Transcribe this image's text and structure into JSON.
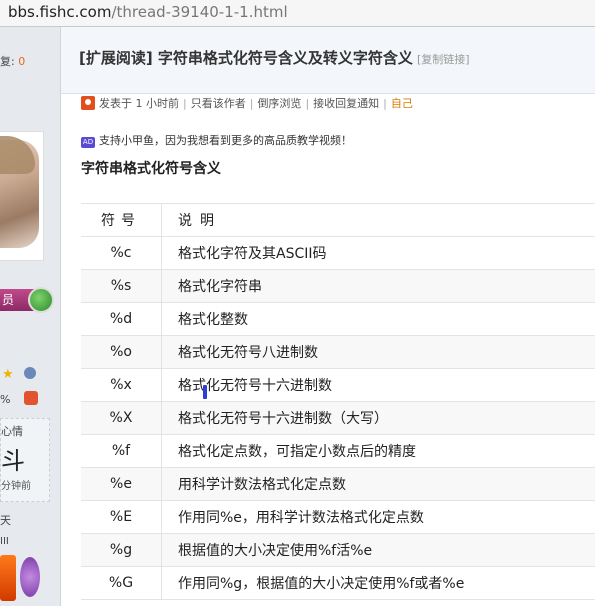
{
  "browser": {
    "url_domain": "bbs.fishc.com",
    "url_path": "/thread-39140-1-1.html"
  },
  "sidebar": {
    "reply_label": "复:",
    "reply_count": "0",
    "vip_label": "员",
    "percent_text": "%",
    "mood_line1": "心情",
    "mood_line2": "斗",
    "mood_line3": "分钟前",
    "days_text": "天",
    "level_text": "III"
  },
  "post": {
    "title": "[扩展阅读] 字符串格式化符号含义及转义字符含义",
    "copy_link": "[复制链接]",
    "posted": "发表于 1 小时前",
    "only_author": "只看该作者",
    "reverse": "倒序浏览",
    "notify": "接收回复通知",
    "self": "自己",
    "ad_text": "支持小甲鱼，因为我想看到更多的高品质教学视频！",
    "ad_badge": "AD",
    "section_title": "字符串格式化符号含义"
  },
  "table": {
    "headers": [
      "符号",
      "说明"
    ],
    "rows": [
      {
        "sym": "%c",
        "desc": "格式化字符及其ASCII码"
      },
      {
        "sym": "%s",
        "desc": "格式化字符串"
      },
      {
        "sym": "%d",
        "desc": "格式化整数"
      },
      {
        "sym": "%o",
        "desc": "格式化无符号八进制数"
      },
      {
        "sym": "%x",
        "desc": "格式化无符号十六进制数"
      },
      {
        "sym": "%X",
        "desc": "格式化无符号十六进制数（大写）"
      },
      {
        "sym": "%f",
        "desc": "格式化定点数，可指定小数点后的精度"
      },
      {
        "sym": "%e",
        "desc": "用科学计数法格式化定点数"
      },
      {
        "sym": "%E",
        "desc": "作用同%e，用科学计数法格式化定点数"
      },
      {
        "sym": "%g",
        "desc": "根据值的大小决定使用%f活%e"
      },
      {
        "sym": "%G",
        "desc": "作用同%g，根据值的大小决定使用%f或者%e"
      }
    ]
  },
  "colors": {
    "accent_orange": "#e06a1b",
    "vip_purple": "#8d2a67"
  }
}
